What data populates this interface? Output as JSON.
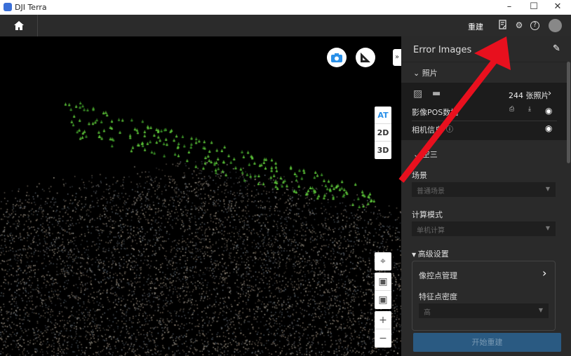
{
  "window": {
    "title": "DJI Terra",
    "minimize": "–",
    "maximize": "☐",
    "close": "✕"
  },
  "toolbar": {
    "rebuild_label": "重建"
  },
  "map": {
    "modes": [
      "AT",
      "2D",
      "3D"
    ],
    "expand": "»",
    "zoom_in": "+",
    "zoom_out": "−",
    "accent": "#2a90e8"
  },
  "panel": {
    "title": "Error Images",
    "photos_section": "照片",
    "photo_count": "244 张照片",
    "pos_label": "影像POS数据",
    "camera_label": "相机信息",
    "aerotriangulation_section": "空三",
    "scene_label": "场景",
    "scene_value": "普通场景",
    "calc_mode_label": "计算模式",
    "calc_mode_value": "单机计算",
    "advanced_label": "高级设置",
    "gcp_label": "像控点管理",
    "feature_density_label": "特征点密度",
    "feature_density_value": "高",
    "start_button": "开始重建"
  }
}
